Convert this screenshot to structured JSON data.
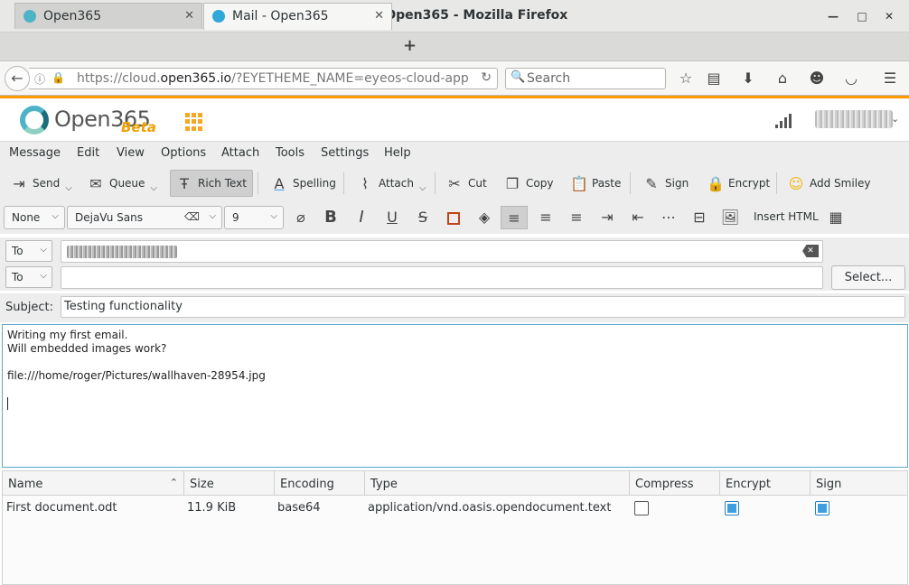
{
  "window": {
    "title": "Mail - Open365 - Mozilla Firefox"
  },
  "tabs": [
    {
      "label": "Open365",
      "active": false
    },
    {
      "label": "Mail - Open365",
      "active": true
    }
  ],
  "nav": {
    "url_prefix": "https://cloud.",
    "url_domain": "open365.io",
    "url_suffix": "/?EYETHEME_NAME=eyeos-cloud-app",
    "search_placeholder": "Search"
  },
  "app": {
    "logo_text": "Open365",
    "logo_badge": "Beta"
  },
  "menu": [
    "Message",
    "Edit",
    "View",
    "Options",
    "Attach",
    "Tools",
    "Settings",
    "Help"
  ],
  "toolbar": {
    "send": "Send",
    "queue": "Queue",
    "rich_text": "Rich Text",
    "spelling": "Spelling",
    "attach": "Attach",
    "cut": "Cut",
    "copy": "Copy",
    "paste": "Paste",
    "sign": "Sign",
    "encrypt": "Encrypt",
    "add_smiley": "Add Smiley"
  },
  "format": {
    "paragraph_style": "None",
    "font_family": "DejaVu Sans",
    "font_size": "9",
    "insert_html": "Insert HTML"
  },
  "recipients": {
    "row1_type": "To",
    "row2_type": "To",
    "select_button": "Select..."
  },
  "subject": {
    "label": "Subject:",
    "value": "Testing functionality"
  },
  "body": {
    "lines": [
      "Writing my first email.",
      "Will embedded images work?",
      "",
      "file:///home/roger/Pictures/wallhaven-28954.jpg"
    ]
  },
  "attachments": {
    "columns": [
      "Name",
      "Size",
      "Encoding",
      "Type",
      "Compress",
      "Encrypt",
      "Sign"
    ],
    "rows": [
      {
        "name": "First document.odt",
        "size": "11.9 KiB",
        "encoding": "base64",
        "type": "application/vnd.oasis.opendocument.text",
        "compress": false,
        "encrypt": true,
        "sign": true
      }
    ]
  },
  "colors": {
    "accent": "#ff9900",
    "checkbox": "#3d9fe0",
    "editor_border": "#5aa7c6"
  }
}
